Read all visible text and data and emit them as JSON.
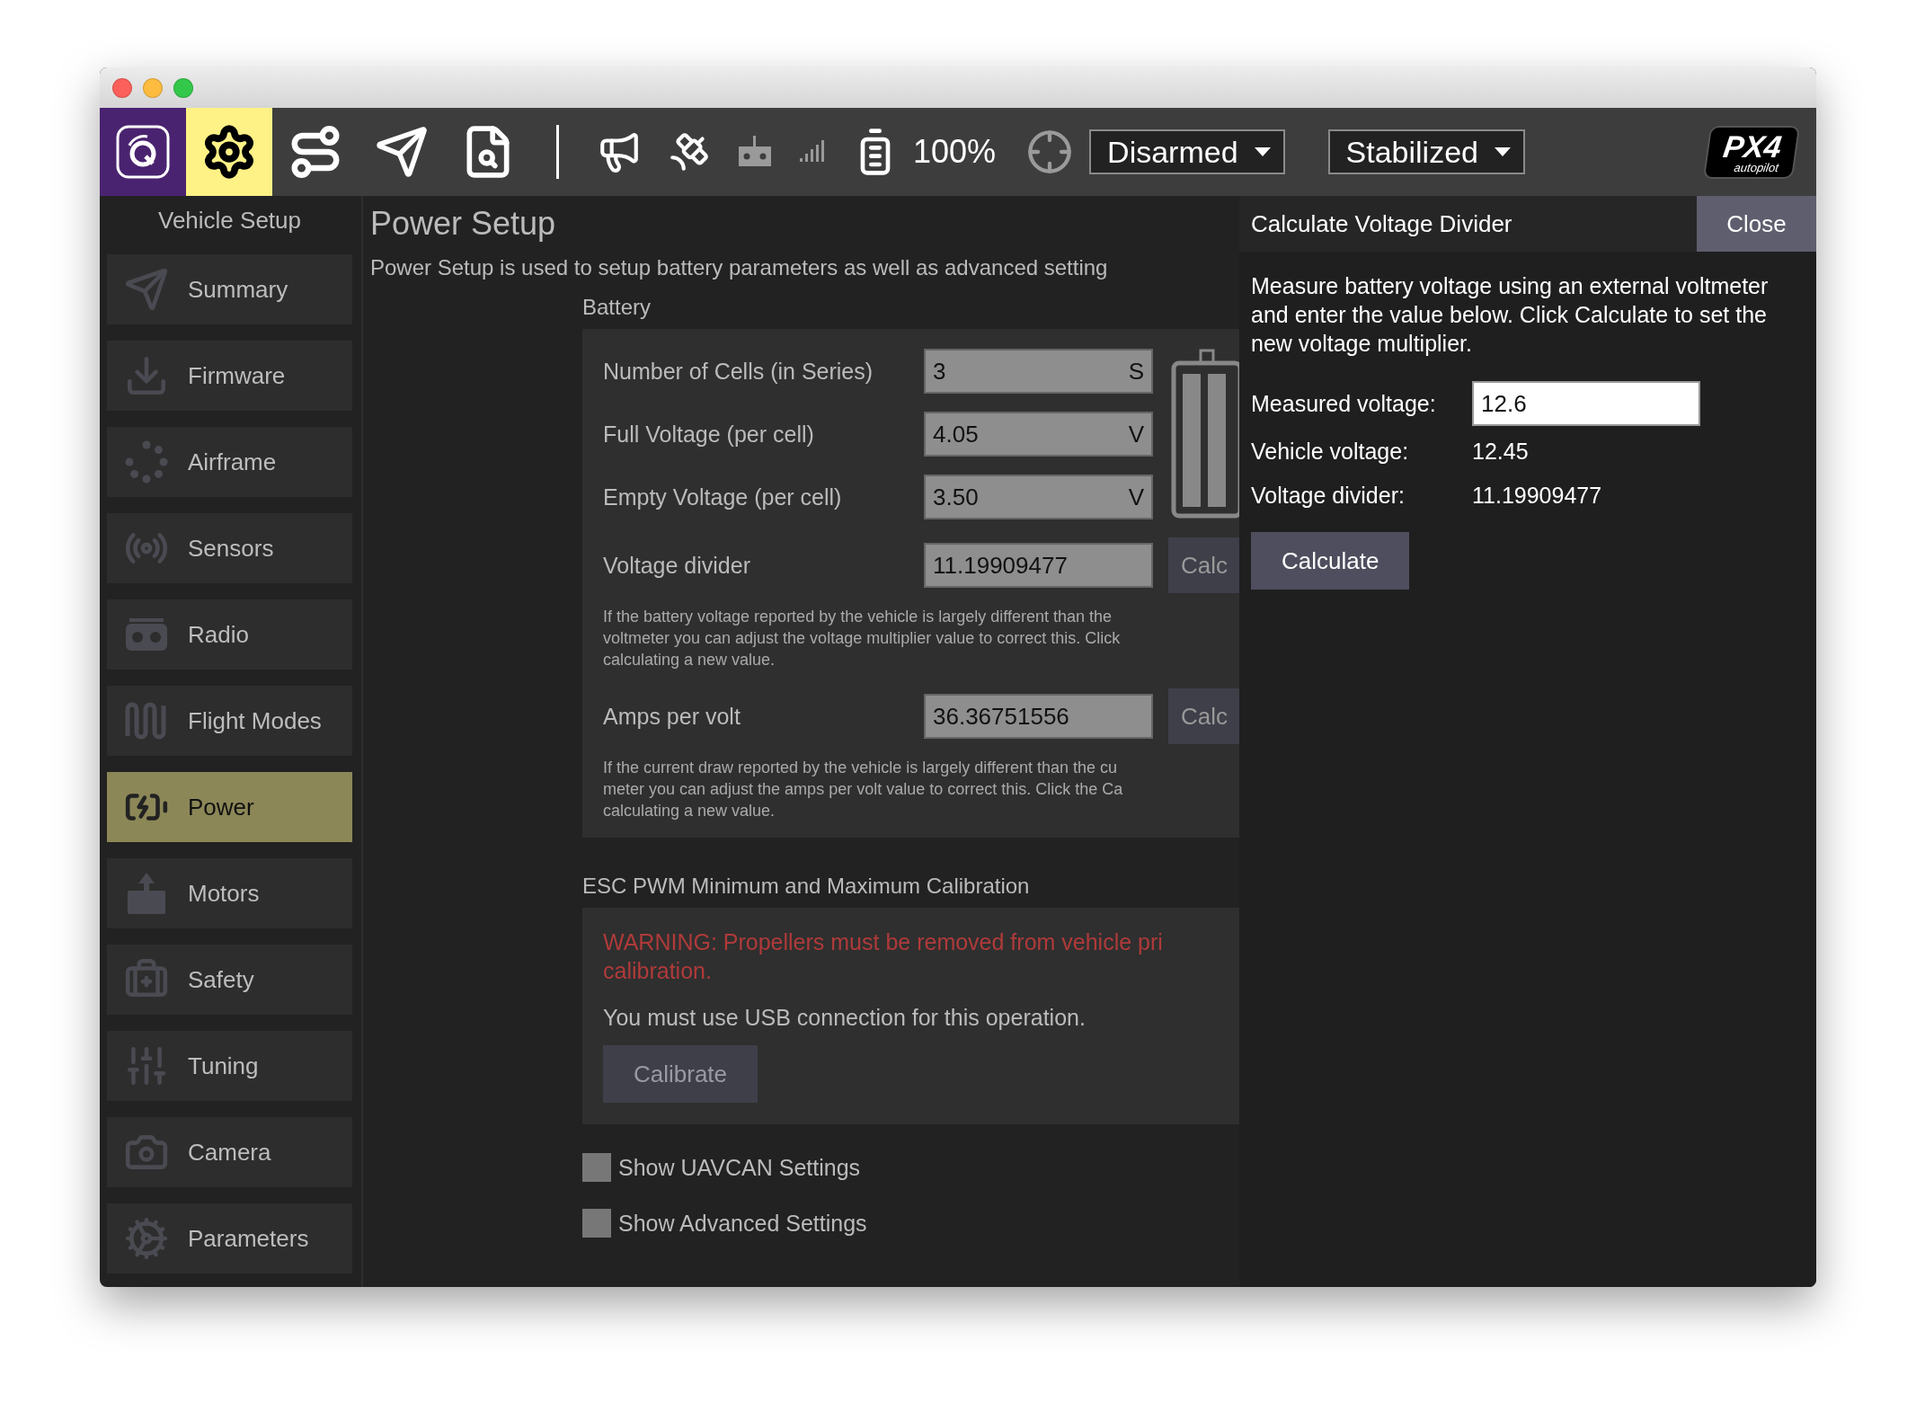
{
  "toolbar": {
    "views": [
      {
        "kind": "app",
        "selected": false
      },
      {
        "kind": "setup",
        "selected": true
      },
      {
        "kind": "plan",
        "selected": false
      },
      {
        "kind": "fly",
        "selected": false
      },
      {
        "kind": "analyze",
        "selected": false
      }
    ],
    "battery_reading": "100%",
    "arm_state": "Disarmed",
    "flight_mode": "Stabilized",
    "logo_text": "PX4",
    "logo_subtext": "autopilot"
  },
  "sidebar": {
    "title": "Vehicle Setup",
    "items": [
      {
        "label": "Summary",
        "kind": "summary",
        "selected": false
      },
      {
        "label": "Firmware",
        "kind": "firmware",
        "selected": false
      },
      {
        "label": "Airframe",
        "kind": "airframe",
        "selected": false
      },
      {
        "label": "Sensors",
        "kind": "sensors",
        "selected": false
      },
      {
        "label": "Radio",
        "kind": "radio",
        "selected": false
      },
      {
        "label": "Flight Modes",
        "kind": "modes",
        "selected": false
      },
      {
        "label": "Power",
        "kind": "power",
        "selected": true
      },
      {
        "label": "Motors",
        "kind": "motors",
        "selected": false
      },
      {
        "label": "Safety",
        "kind": "safety",
        "selected": false
      },
      {
        "label": "Tuning",
        "kind": "tuning",
        "selected": false
      },
      {
        "label": "Camera",
        "kind": "camera",
        "selected": false
      },
      {
        "label": "Parameters",
        "kind": "parameters",
        "selected": false
      }
    ]
  },
  "page": {
    "title": "Power Setup",
    "description": "Power Setup is used to setup battery parameters as well as advanced setting",
    "battery": {
      "title": "Battery",
      "rows": [
        {
          "label": "Number of Cells (in Series)",
          "value": "3",
          "unit": "S"
        },
        {
          "label": "Full Voltage (per cell)",
          "value": "4.05",
          "unit": "V"
        },
        {
          "label": "Empty Voltage (per cell)",
          "value": "3.50",
          "unit": "V"
        },
        {
          "label": "Voltage divider",
          "value": "11.19909477",
          "button": "Calc",
          "help": [
            "If the battery voltage reported by the vehicle is largely different than the",
            "voltmeter you can adjust the voltage multiplier value to correct this. Click",
            "calculating a new value."
          ]
        },
        {
          "label": "Amps per volt",
          "value": "36.36751556",
          "button": "Calc",
          "help": [
            "If the current draw reported by the vehicle is largely different than the cu",
            "meter you can adjust the amps per volt value to correct this. Click the Ca",
            "calculating a new value."
          ]
        }
      ]
    },
    "esc": {
      "title": "ESC PWM Minimum and Maximum Calibration",
      "warning": [
        "WARNING: Propellers must be removed from vehicle pri",
        "calibration."
      ],
      "note": "You must use USB connection for this operation.",
      "button": "Calibrate"
    },
    "checkboxes": [
      {
        "label": "Show UAVCAN Settings",
        "checked": false
      },
      {
        "label": "Show Advanced Settings",
        "checked": false
      }
    ]
  },
  "dialog": {
    "title": "Calculate Voltage Divider",
    "close": "Close",
    "description": "Measure battery voltage using an external voltmeter and enter the value below. Click Calculate to set the new voltage multiplier.",
    "measured": {
      "label": "Measured voltage:",
      "value": "12.6"
    },
    "readings": [
      {
        "label": "Vehicle voltage:",
        "value": "12.45"
      },
      {
        "label": "Voltage divider:",
        "value": "11.19909477"
      }
    ],
    "button": "Calculate"
  }
}
